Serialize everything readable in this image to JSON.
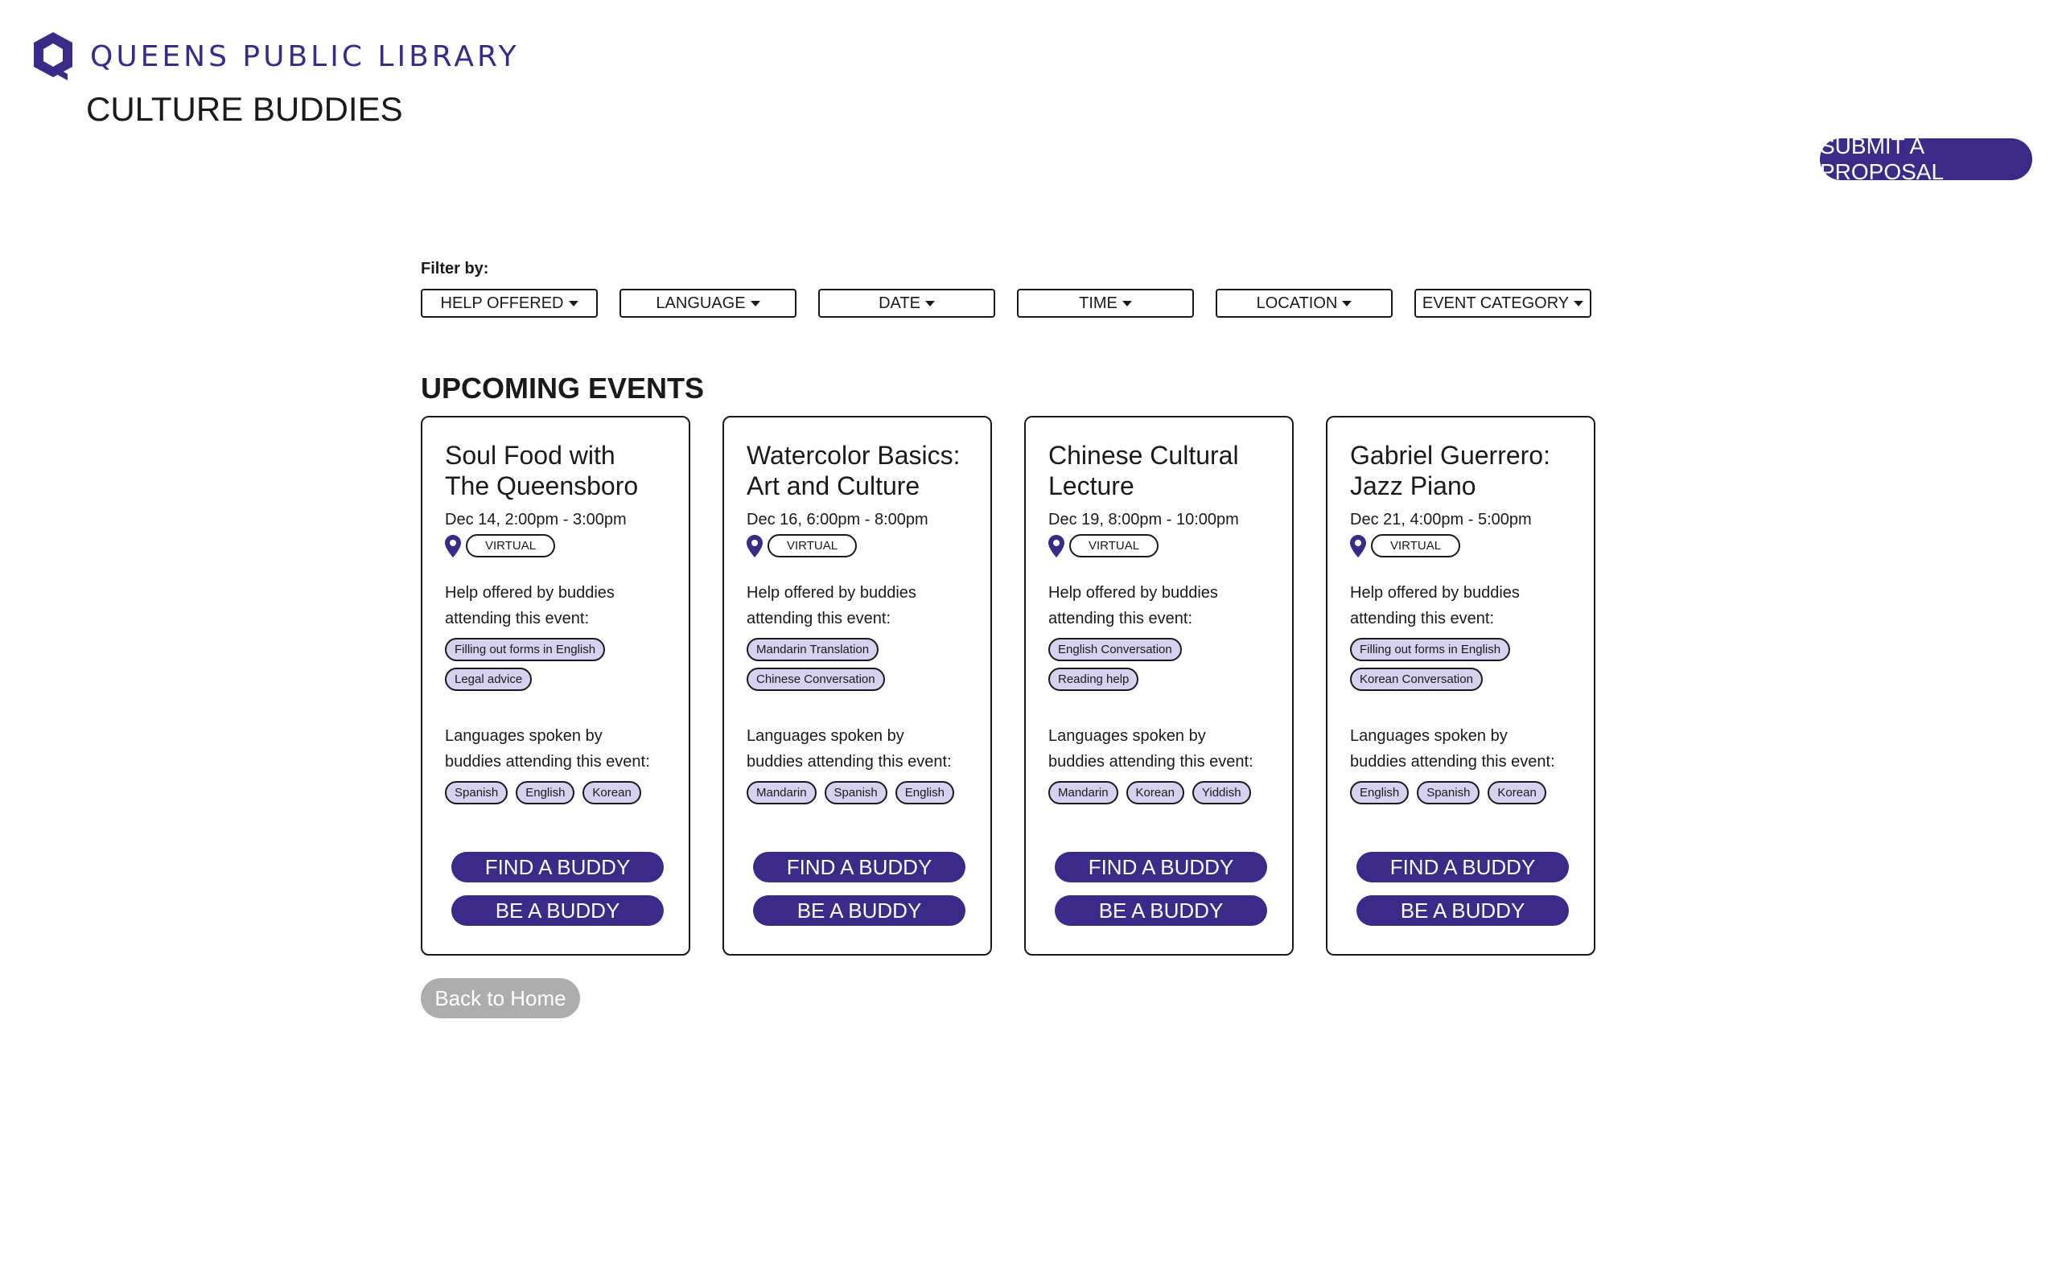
{
  "brand": {
    "logo_text": "QUEENS PUBLIC LIBRARY",
    "app_title": "CULTURE BUDDIES",
    "accent_color": "#3b2a87",
    "tag_color": "#d6d1ef"
  },
  "header": {
    "proposal_button": "SUBMIT A PROPOSAL"
  },
  "filters": {
    "label": "Filter by:",
    "items": [
      {
        "label": "HELP OFFERED",
        "icon": "caret-down-icon"
      },
      {
        "label": "LANGUAGE",
        "icon": "caret-down-icon"
      },
      {
        "label": "DATE",
        "icon": "caret-down-icon"
      },
      {
        "label": "TIME",
        "icon": "caret-down-icon"
      },
      {
        "label": "LOCATION",
        "icon": "caret-down-icon"
      },
      {
        "label": "EVENT CATEGORY",
        "icon": "caret-down-icon"
      }
    ]
  },
  "events": {
    "section_title": "UPCOMING EVENTS",
    "help_label": "Help offered by buddies attending this event:",
    "languages_label": "Languages spoken by buddies attending this event:",
    "find_button": "FIND A BUDDY",
    "be_button": "BE A BUDDY",
    "location_icon": "map-pin-icon",
    "cards": [
      {
        "title": "Soul Food with The Queensboro",
        "date": "Dec 14, 2:00pm - 3:00pm",
        "location": "VIRTUAL",
        "help": [
          "Filling out forms in English",
          "Legal advice"
        ],
        "languages": [
          "Spanish",
          "English",
          "Korean"
        ]
      },
      {
        "title": "Watercolor Basics: Art and Culture",
        "date": "Dec 16, 6:00pm - 8:00pm",
        "location": "VIRTUAL",
        "help": [
          "Mandarin Translation",
          "Chinese Conversation"
        ],
        "languages": [
          "Mandarin",
          "Spanish",
          "English"
        ]
      },
      {
        "title": "Chinese Cultural Lecture",
        "date": "Dec 19, 8:00pm - 10:00pm",
        "location": "VIRTUAL",
        "help": [
          "English Conversation",
          "Reading help"
        ],
        "languages": [
          "Mandarin",
          "Korean",
          "Yiddish"
        ]
      },
      {
        "title": "Gabriel Guerrero: Jazz Piano",
        "date": "Dec 21, 4:00pm - 5:00pm",
        "location": "VIRTUAL",
        "help": [
          "Filling out forms in English",
          "Korean Conversation"
        ],
        "languages": [
          "English",
          "Spanish",
          "Korean"
        ]
      }
    ]
  },
  "footer": {
    "home_button": "Back to Home"
  }
}
